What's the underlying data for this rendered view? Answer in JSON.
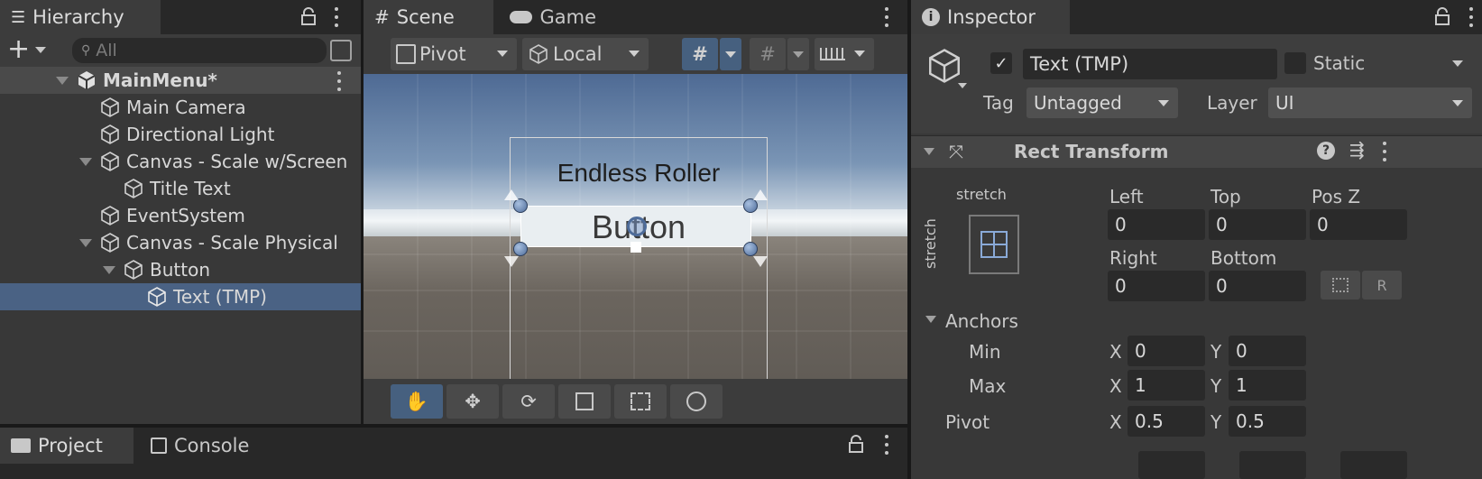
{
  "hierarchy": {
    "tab_label": "Hierarchy",
    "search_placeholder": "All",
    "scene_name": "MainMenu*",
    "items": [
      {
        "label": "Main Camera"
      },
      {
        "label": "Directional Light"
      },
      {
        "label": "Canvas - Scale w/Screen"
      },
      {
        "label": "Title Text"
      },
      {
        "label": "EventSystem"
      },
      {
        "label": "Canvas - Scale Physical"
      },
      {
        "label": "Button"
      },
      {
        "label": "Text (TMP)"
      }
    ]
  },
  "scene": {
    "tab_scene": "Scene",
    "tab_game": "Game",
    "pivot_label": "Pivot",
    "local_label": "Local",
    "canvas_title": "Endless Roller",
    "button_text": "Button",
    "sky_color": "#7a95b5",
    "ground_color": "#6e6860"
  },
  "bottom": {
    "tab_project": "Project",
    "tab_console": "Console"
  },
  "inspector": {
    "tab_label": "Inspector",
    "object_name": "Text (TMP)",
    "active_checked": true,
    "static_label": "Static",
    "tag_label": "Tag",
    "tag_value": "Untagged",
    "layer_label": "Layer",
    "layer_value": "UI",
    "component_title": "Rect Transform",
    "anchor_preset_h": "stretch",
    "anchor_preset_v": "stretch",
    "left_label": "Left",
    "left_value": "0",
    "top_label": "Top",
    "top_value": "0",
    "posz_label": "Pos Z",
    "posz_value": "0",
    "right_label": "Right",
    "right_value": "0",
    "bottom_label": "Bottom",
    "bottom_value": "0",
    "r_button": "R",
    "anchors_label": "Anchors",
    "min_label": "Min",
    "max_label": "Max",
    "pivot_label": "Pivot",
    "x_label": "X",
    "y_label": "Y",
    "min_x": "0",
    "min_y": "0",
    "max_x": "1",
    "max_y": "1",
    "pivot_x": "0.5",
    "pivot_y": "0.5"
  },
  "colors": {
    "selection": "#4a6284",
    "accent": "#46607f"
  }
}
